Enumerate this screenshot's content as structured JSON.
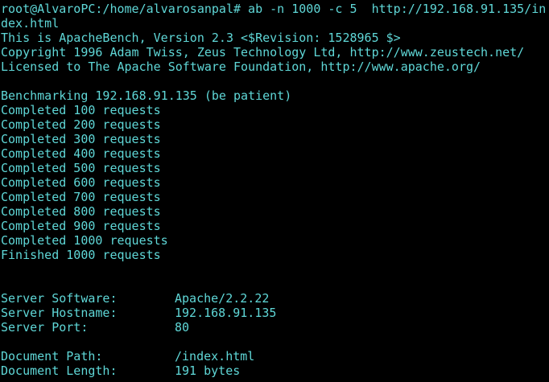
{
  "terminal": {
    "text_color": "#5fd7d7",
    "background": "#000000",
    "command_line_1": "root@AlvaroPC:/home/alvarosanpal# ab -n 1000 -c 5  http://192.168.91.135/in",
    "command_line_2": "dex.html",
    "version_line": "This is ApacheBench, Version 2.3 <$Revision: 1528965 $>",
    "copyright_line": "Copyright 1996 Adam Twiss, Zeus Technology Ltd, http://www.zeustech.net/",
    "license_line": "Licensed to The Apache Software Foundation, http://www.apache.org/",
    "benchmarking_line": "Benchmarking 192.168.91.135 (be patient)",
    "progress": [
      "Completed 100 requests",
      "Completed 200 requests",
      "Completed 300 requests",
      "Completed 400 requests",
      "Completed 500 requests",
      "Completed 600 requests",
      "Completed 700 requests",
      "Completed 800 requests",
      "Completed 900 requests",
      "Completed 1000 requests",
      "Finished 1000 requests"
    ],
    "server": [
      {
        "key": "Server Software:",
        "value": "Apache/2.2.22"
      },
      {
        "key": "Server Hostname:",
        "value": "192.168.91.135"
      },
      {
        "key": "Server Port:",
        "value": "80"
      }
    ],
    "document": [
      {
        "key": "Document Path:",
        "value": "/index.html"
      },
      {
        "key": "Document Length:",
        "value": "191 bytes"
      }
    ]
  }
}
